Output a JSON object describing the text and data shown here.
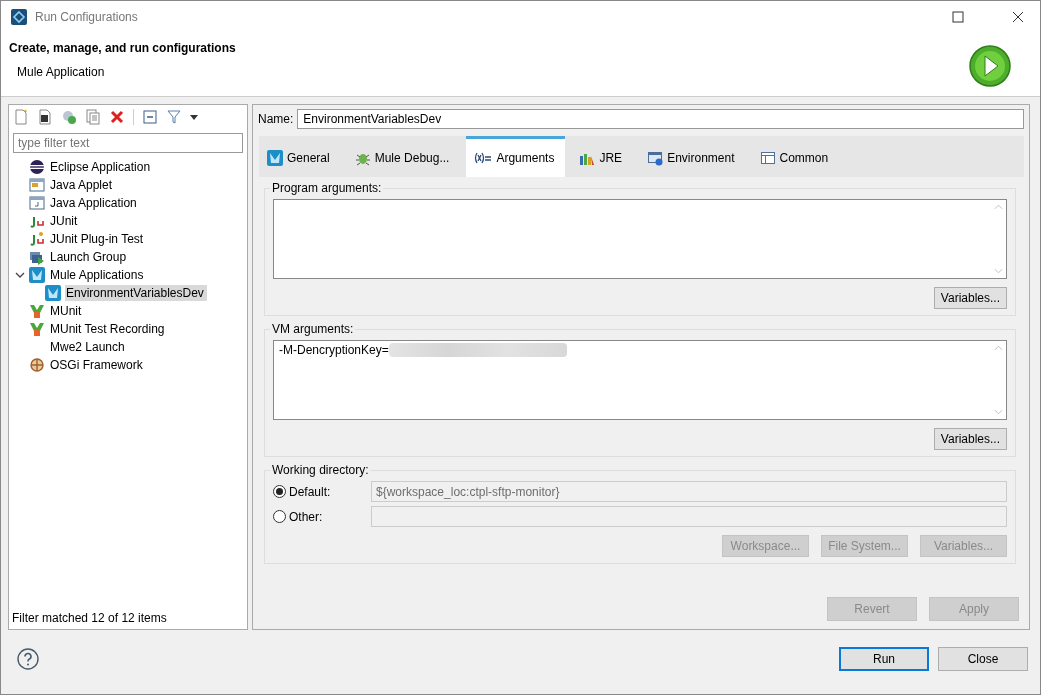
{
  "window": {
    "title": "Run Configurations"
  },
  "header": {
    "title": "Create, manage, and run configurations",
    "subtitle": "Mule Application"
  },
  "filter": {
    "placeholder": "type filter text"
  },
  "tree": [
    {
      "label": "Eclipse Application",
      "kind": "eclipse",
      "selected": false
    },
    {
      "label": "Java Applet",
      "kind": "applet",
      "selected": false
    },
    {
      "label": "Java Application",
      "kind": "java",
      "selected": false
    },
    {
      "label": "JUnit",
      "kind": "junit",
      "selected": false
    },
    {
      "label": "JUnit Plug-in Test",
      "kind": "junitplugin",
      "selected": false
    },
    {
      "label": "Launch Group",
      "kind": "launch",
      "selected": false
    },
    {
      "label": "Mule Applications",
      "kind": "mule",
      "selected": false,
      "expanded": true,
      "children": [
        {
          "label": "EnvironmentVariablesDev",
          "kind": "mule",
          "selected": true
        }
      ]
    },
    {
      "label": "MUnit",
      "kind": "munit",
      "selected": false
    },
    {
      "label": "MUnit Test Recording",
      "kind": "munit",
      "selected": false
    },
    {
      "label": "Mwe2 Launch",
      "kind": "none",
      "selected": false
    },
    {
      "label": "OSGi Framework",
      "kind": "osgi",
      "selected": false
    }
  ],
  "filter_status": "Filter matched 12 of 12 items",
  "name": {
    "label": "Name:",
    "value": "EnvironmentVariablesDev"
  },
  "tabs": [
    {
      "label": "General",
      "kind": "mule",
      "selected": false
    },
    {
      "label": "Mule Debug...",
      "kind": "bug",
      "selected": false
    },
    {
      "label": "Arguments",
      "kind": "args",
      "selected": true
    },
    {
      "label": "JRE",
      "kind": "jre",
      "selected": false
    },
    {
      "label": "Environment",
      "kind": "env",
      "selected": false
    },
    {
      "label": "Common",
      "kind": "common",
      "selected": false
    }
  ],
  "program_arguments": {
    "label": "Program arguments:",
    "button": {
      "label": "Variables...",
      "disabled": false
    }
  },
  "vm_arguments": {
    "label": "VM arguments:",
    "value": "-M-DencryptionKey=",
    "redacted": true,
    "button": {
      "label": "Variables...",
      "disabled": false
    }
  },
  "working_directory": {
    "label": "Working directory:",
    "options": [
      {
        "label": "Default:",
        "selected": true,
        "disabled": true,
        "value": "${workspace_loc:ctpl-sftp-monitor}"
      },
      {
        "label": "Other:",
        "selected": false,
        "disabled": true
      }
    ],
    "buttons": [
      {
        "label": "Workspace...",
        "disabled": true
      },
      {
        "label": "File System...",
        "disabled": true
      },
      {
        "label": "Variables...",
        "disabled": true
      }
    ]
  },
  "form_buttons": [
    {
      "label": "Revert",
      "disabled": true
    },
    {
      "label": "Apply",
      "disabled": true
    }
  ],
  "dialog_buttons": [
    {
      "label": "Run",
      "default": true
    },
    {
      "label": "Close",
      "default": false
    }
  ]
}
